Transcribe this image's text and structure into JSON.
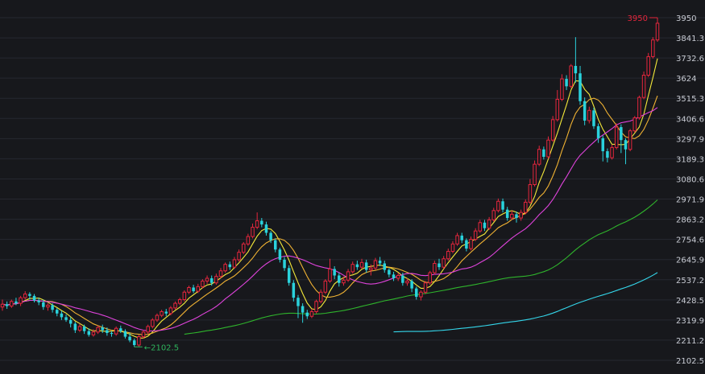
{
  "chart_data": {
    "type": "candlestick",
    "y_axis": {
      "position": "right",
      "ticks": [
        3950,
        3841.3,
        3732.6,
        3624,
        3515.3,
        3406.6,
        3297.9,
        3189.3,
        3080.6,
        2971.9,
        2863.2,
        2754.6,
        2645.9,
        2537.2,
        2428.5,
        2319.9,
        2211.2,
        2102.5
      ],
      "range": [
        2102.5,
        3950
      ]
    },
    "grid": true,
    "annotations": {
      "max_label": "3950",
      "min_label": "2102.5"
    },
    "colors": {
      "background": "#17181c",
      "grid": "#262830",
      "up": "#e5263d",
      "down": "#2ad2dc",
      "ma5": "#f4e93a",
      "ma10": "#f0b233",
      "ma20": "#e043dc",
      "ma60": "#2fb52c",
      "ma120": "#34d6ea",
      "max_label": "#e5263d",
      "min_label": "#2fb55d",
      "tick_text": "#c9ccd4"
    },
    "candles": [
      [
        2390,
        2405,
        2370,
        2430
      ],
      [
        2405,
        2395,
        2380,
        2420
      ],
      [
        2395,
        2420,
        2385,
        2430
      ],
      [
        2420,
        2410,
        2400,
        2440
      ],
      [
        2410,
        2440,
        2395,
        2450
      ],
      [
        2440,
        2460,
        2430,
        2475
      ],
      [
        2460,
        2450,
        2430,
        2470
      ],
      [
        2450,
        2425,
        2415,
        2460
      ],
      [
        2425,
        2415,
        2400,
        2440
      ],
      [
        2415,
        2390,
        2375,
        2430
      ],
      [
        2390,
        2400,
        2370,
        2410
      ],
      [
        2400,
        2375,
        2360,
        2410
      ],
      [
        2375,
        2355,
        2340,
        2385
      ],
      [
        2355,
        2335,
        2320,
        2370
      ],
      [
        2335,
        2320,
        2310,
        2350
      ],
      [
        2320,
        2300,
        2280,
        2335
      ],
      [
        2300,
        2265,
        2250,
        2310
      ],
      [
        2265,
        2285,
        2255,
        2300
      ],
      [
        2285,
        2260,
        2245,
        2295
      ],
      [
        2260,
        2240,
        2230,
        2275
      ],
      [
        2240,
        2255,
        2230,
        2270
      ],
      [
        2255,
        2280,
        2245,
        2290
      ],
      [
        2280,
        2265,
        2250,
        2295
      ],
      [
        2265,
        2250,
        2235,
        2280
      ],
      [
        2250,
        2245,
        2230,
        2260
      ],
      [
        2245,
        2275,
        2235,
        2285
      ],
      [
        2275,
        2260,
        2250,
        2290
      ],
      [
        2260,
        2230,
        2220,
        2270
      ],
      [
        2230,
        2210,
        2200,
        2250
      ],
      [
        2210,
        2185,
        2175,
        2220
      ],
      [
        2185,
        2230,
        2175,
        2240
      ],
      [
        2230,
        2255,
        2220,
        2265
      ],
      [
        2255,
        2285,
        2245,
        2295
      ],
      [
        2285,
        2320,
        2275,
        2330
      ],
      [
        2320,
        2345,
        2310,
        2355
      ],
      [
        2345,
        2365,
        2335,
        2375
      ],
      [
        2365,
        2355,
        2340,
        2380
      ],
      [
        2355,
        2385,
        2345,
        2395
      ],
      [
        2385,
        2410,
        2375,
        2420
      ],
      [
        2410,
        2430,
        2400,
        2440
      ],
      [
        2430,
        2470,
        2420,
        2480
      ],
      [
        2470,
        2495,
        2460,
        2505
      ],
      [
        2495,
        2475,
        2465,
        2510
      ],
      [
        2475,
        2500,
        2465,
        2515
      ],
      [
        2500,
        2530,
        2490,
        2540
      ],
      [
        2530,
        2545,
        2515,
        2560
      ],
      [
        2545,
        2520,
        2505,
        2560
      ],
      [
        2520,
        2555,
        2510,
        2570
      ],
      [
        2555,
        2585,
        2545,
        2600
      ],
      [
        2585,
        2620,
        2575,
        2630
      ],
      [
        2620,
        2605,
        2590,
        2635
      ],
      [
        2605,
        2645,
        2595,
        2660
      ],
      [
        2645,
        2685,
        2635,
        2700
      ],
      [
        2685,
        2730,
        2675,
        2740
      ],
      [
        2730,
        2770,
        2720,
        2785
      ],
      [
        2770,
        2820,
        2760,
        2840
      ],
      [
        2820,
        2855,
        2810,
        2900
      ],
      [
        2855,
        2835,
        2820,
        2870
      ],
      [
        2835,
        2790,
        2775,
        2850
      ],
      [
        2790,
        2750,
        2735,
        2800
      ],
      [
        2750,
        2700,
        2685,
        2760
      ],
      [
        2700,
        2645,
        2630,
        2710
      ],
      [
        2645,
        2600,
        2585,
        2660
      ],
      [
        2600,
        2520,
        2505,
        2615
      ],
      [
        2520,
        2440,
        2420,
        2535
      ],
      [
        2440,
        2395,
        2330,
        2455
      ],
      [
        2395,
        2360,
        2305,
        2410
      ],
      [
        2360,
        2340,
        2325,
        2375
      ],
      [
        2340,
        2365,
        2330,
        2380
      ],
      [
        2365,
        2420,
        2355,
        2430
      ],
      [
        2420,
        2470,
        2410,
        2485
      ],
      [
        2470,
        2530,
        2460,
        2540
      ],
      [
        2530,
        2595,
        2520,
        2650
      ],
      [
        2595,
        2560,
        2540,
        2610
      ],
      [
        2560,
        2520,
        2500,
        2575
      ],
      [
        2520,
        2535,
        2505,
        2555
      ],
      [
        2535,
        2580,
        2525,
        2595
      ],
      [
        2580,
        2620,
        2570,
        2635
      ],
      [
        2620,
        2605,
        2590,
        2640
      ],
      [
        2605,
        2630,
        2595,
        2650
      ],
      [
        2630,
        2590,
        2575,
        2645
      ],
      [
        2590,
        2600,
        2560,
        2620
      ],
      [
        2600,
        2640,
        2590,
        2655
      ],
      [
        2640,
        2625,
        2610,
        2660
      ],
      [
        2625,
        2590,
        2575,
        2640
      ],
      [
        2590,
        2565,
        2550,
        2600
      ],
      [
        2565,
        2545,
        2530,
        2580
      ],
      [
        2545,
        2560,
        2530,
        2575
      ],
      [
        2560,
        2520,
        2505,
        2575
      ],
      [
        2520,
        2530,
        2505,
        2545
      ],
      [
        2530,
        2490,
        2470,
        2540
      ],
      [
        2490,
        2445,
        2430,
        2500
      ],
      [
        2445,
        2470,
        2425,
        2480
      ],
      [
        2470,
        2520,
        2460,
        2530
      ],
      [
        2520,
        2575,
        2510,
        2585
      ],
      [
        2575,
        2625,
        2565,
        2640
      ],
      [
        2625,
        2605,
        2590,
        2650
      ],
      [
        2605,
        2650,
        2595,
        2665
      ],
      [
        2650,
        2690,
        2640,
        2705
      ],
      [
        2690,
        2730,
        2680,
        2745
      ],
      [
        2730,
        2775,
        2720,
        2790
      ],
      [
        2775,
        2750,
        2735,
        2790
      ],
      [
        2750,
        2705,
        2690,
        2760
      ],
      [
        2705,
        2755,
        2695,
        2770
      ],
      [
        2755,
        2800,
        2745,
        2815
      ],
      [
        2800,
        2845,
        2790,
        2860
      ],
      [
        2845,
        2815,
        2800,
        2860
      ],
      [
        2815,
        2860,
        2805,
        2875
      ],
      [
        2860,
        2910,
        2850,
        2925
      ],
      [
        2910,
        2960,
        2900,
        2975
      ],
      [
        2960,
        2915,
        2900,
        2975
      ],
      [
        2915,
        2870,
        2855,
        2930
      ],
      [
        2870,
        2890,
        2860,
        2910
      ],
      [
        2890,
        2870,
        2845,
        2905
      ],
      [
        2870,
        2900,
        2855,
        2915
      ],
      [
        2900,
        2955,
        2890,
        2970
      ],
      [
        2955,
        3050,
        2945,
        3080
      ],
      [
        3050,
        3160,
        3040,
        3180
      ],
      [
        3160,
        3240,
        3150,
        3260
      ],
      [
        3240,
        3200,
        3185,
        3255
      ],
      [
        3200,
        3290,
        3190,
        3310
      ],
      [
        3290,
        3400,
        3280,
        3420
      ],
      [
        3400,
        3510,
        3390,
        3560
      ],
      [
        3510,
        3620,
        3500,
        3645
      ],
      [
        3620,
        3580,
        3560,
        3640
      ],
      [
        3580,
        3690,
        3570,
        3700
      ],
      [
        3690,
        3650,
        3600,
        3845
      ],
      [
        3650,
        3500,
        3480,
        3690
      ],
      [
        3500,
        3395,
        3370,
        3520
      ],
      [
        3395,
        3450,
        3380,
        3470
      ],
      [
        3450,
        3365,
        3350,
        3465
      ],
      [
        3365,
        3300,
        3275,
        3380
      ],
      [
        3300,
        3230,
        3175,
        3315
      ],
      [
        3230,
        3195,
        3170,
        3245
      ],
      [
        3195,
        3250,
        3185,
        3265
      ],
      [
        3250,
        3360,
        3240,
        3380
      ],
      [
        3360,
        3290,
        3220,
        3375
      ],
      [
        3290,
        3240,
        3160,
        3300
      ],
      [
        3240,
        3340,
        3230,
        3350
      ],
      [
        3340,
        3410,
        3330,
        3420
      ],
      [
        3410,
        3520,
        3400,
        3530
      ],
      [
        3520,
        3640,
        3510,
        3660
      ],
      [
        3640,
        3740,
        3630,
        3760
      ],
      [
        3740,
        3830,
        3730,
        3845
      ],
      [
        3830,
        3920,
        3820,
        3950
      ]
    ],
    "ma_periods": [
      5,
      10,
      20,
      60,
      120
    ]
  }
}
